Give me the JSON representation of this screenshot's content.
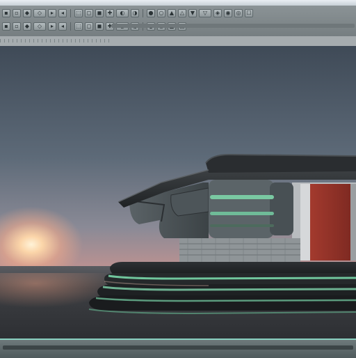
{
  "window": {
    "title": "",
    "accent_color": "#8ad0c0"
  },
  "toolbar": {
    "row1_icons": [
      "file-icon",
      "open-icon",
      "save-icon",
      "undo-icon",
      "redo-icon",
      "select-icon",
      "move-icon",
      "rotate-icon",
      "scale-icon",
      "snap-icon",
      "render-icon",
      "camera-icon",
      "light-icon",
      "material-icon",
      "layers-icon",
      "settings-icon",
      "help-icon",
      "grid-icon",
      "view-icon",
      "zoom-icon",
      "pan-icon",
      "orbit-icon"
    ],
    "row2_icons": [
      "box-icon",
      "sphere-icon",
      "cylinder-icon",
      "plane-icon",
      "text-icon",
      "spline-icon",
      "modifier-icon",
      "link-icon",
      "group-icon",
      "hide-icon",
      "align-icon",
      "mirror-icon",
      "array-icon",
      "extrude-icon",
      "bevel-icon",
      "lathe-icon"
    ]
  },
  "viewport": {
    "label": "",
    "sky_color": "#4a5663",
    "sunset_color": "#f0a890"
  }
}
